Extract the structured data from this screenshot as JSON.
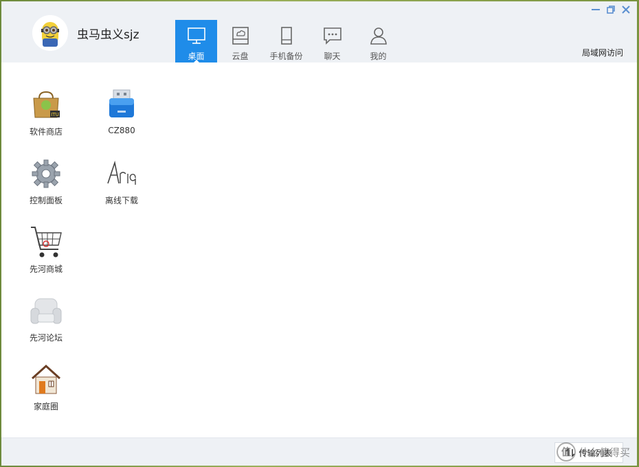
{
  "header": {
    "username": "虫马虫义sjz",
    "nav": [
      {
        "label": "桌面",
        "icon": "monitor-icon",
        "active": true
      },
      {
        "label": "云盘",
        "icon": "cloud-disk-icon",
        "active": false
      },
      {
        "label": "手机备份",
        "icon": "phone-icon",
        "active": false
      },
      {
        "label": "聊天",
        "icon": "chat-icon",
        "active": false
      },
      {
        "label": "我的",
        "icon": "user-icon",
        "active": false
      }
    ],
    "lan_access": "局域网访问"
  },
  "desktop": {
    "apps": [
      {
        "label": "软件商店",
        "icon": "app-store-icon"
      },
      {
        "label": "CZ880",
        "icon": "usb-drive-icon"
      },
      {
        "label": "控制面板",
        "icon": "gear-icon"
      },
      {
        "label": "离线下载",
        "icon": "aria-download-icon"
      },
      {
        "label": "先河商城",
        "icon": "shopping-cart-icon"
      },
      {
        "label": "先河论坛",
        "icon": "sofa-icon"
      },
      {
        "label": "家庭圈",
        "icon": "house-icon"
      }
    ]
  },
  "footer": {
    "transfer_label": "传输列表",
    "watermark": "什么值得买"
  },
  "colors": {
    "accent": "#1f8ce9",
    "header_bg": "#eef1f5"
  }
}
